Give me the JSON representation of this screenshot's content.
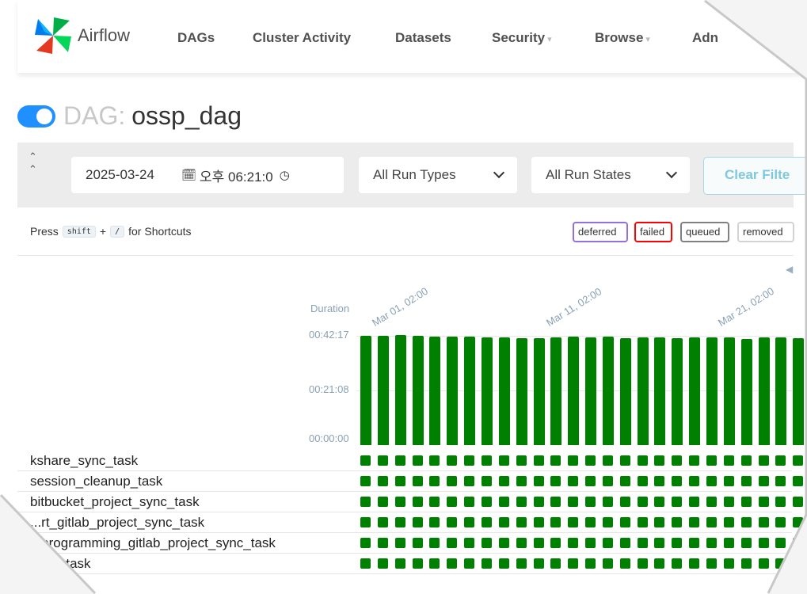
{
  "colors": {
    "success": "#008000",
    "toggle": "#1e90ff",
    "deferred": "#9370db",
    "failed": "#ff0000",
    "queued": "#808080",
    "removed": "#d3d3d3"
  },
  "navbar": {
    "brand": "Airflow",
    "items": [
      {
        "label": "DAGs",
        "dropdown": false
      },
      {
        "label": "Cluster Activity",
        "dropdown": false
      },
      {
        "label": "Datasets",
        "dropdown": false
      },
      {
        "label": "Security",
        "dropdown": true
      },
      {
        "label": "Browse",
        "dropdown": true
      },
      {
        "label": "Adn",
        "dropdown": false
      }
    ]
  },
  "dag": {
    "prefix": "DAG:",
    "name": "ossp_dag",
    "paused": false
  },
  "filters": {
    "date": "2025-03-24",
    "time": "오후 06:21:0",
    "run_types": "All Run Types",
    "run_states": "All Run States",
    "clear_label": "Clear Filte"
  },
  "shortcut": {
    "press": "Press",
    "key1": "shift",
    "plus": "+",
    "key2": "/",
    "suffix": "for Shortcuts"
  },
  "legend": [
    {
      "label": "deferred",
      "color": "#9370db"
    },
    {
      "label": "failed",
      "color": "#ff0000"
    },
    {
      "label": "queued",
      "color": "#808080"
    },
    {
      "label": "removed",
      "color": "#d3d3d3"
    }
  ],
  "grid": {
    "duration_label": "Duration",
    "y_ticks": [
      "00:42:17",
      "00:21:08",
      "00:00:00"
    ],
    "x_labels": [
      "Mar 01, 02:00",
      "Mar 11, 02:00",
      "Mar 21, 02:00"
    ],
    "run_durations_min": [
      42.3,
      42.2,
      42.5,
      42.4,
      41.9,
      42.1,
      42.0,
      41.8,
      41.6,
      41.4,
      41.3,
      41.6,
      41.9,
      41.7,
      41.9,
      41.4,
      41.6,
      41.7,
      41.3,
      41.8,
      41.6,
      41.7,
      41.2,
      41.8,
      41.6,
      41.3
    ],
    "tasks": [
      {
        "label": "kshare_sync_task",
        "status": "success"
      },
      {
        "label": "session_cleanup_task",
        "status": "success"
      },
      {
        "label": "bitbucket_project_sync_task",
        "status": "success"
      },
      {
        "label": "...rt_gitlab_project_sync_task",
        "status": "success"
      },
      {
        "label": "...programming_gitlab_project_sync_task",
        "status": "success"
      },
      {
        "label": "... all_task",
        "status": "success"
      }
    ]
  }
}
